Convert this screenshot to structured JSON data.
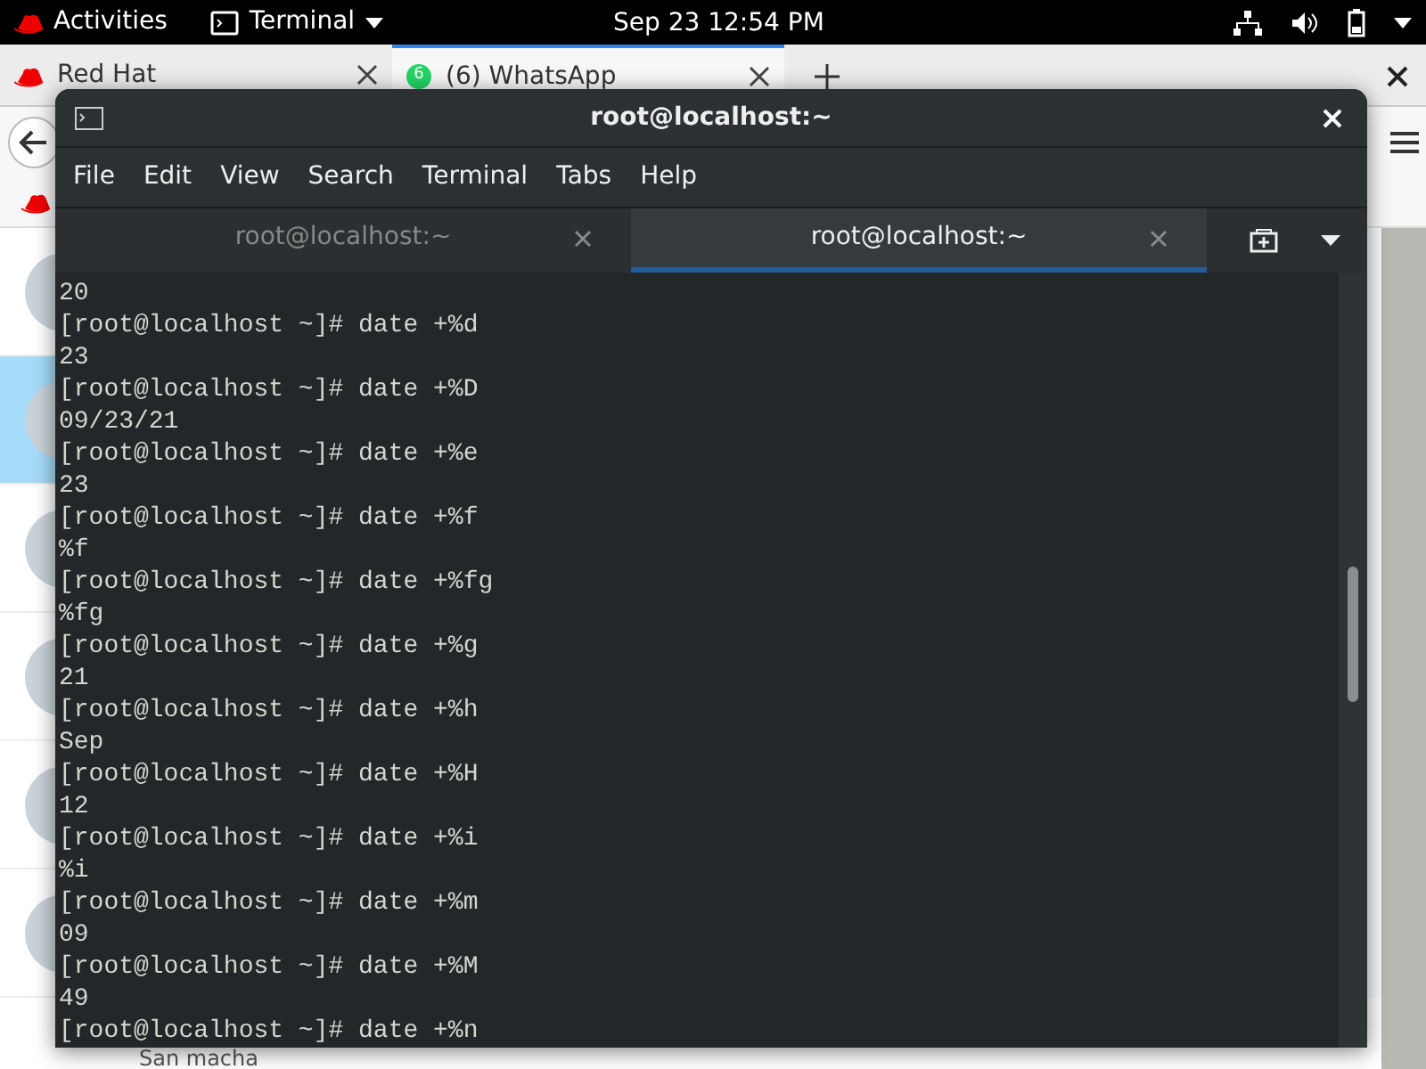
{
  "top_bar": {
    "activities": "Activities",
    "app_menu": "Terminal",
    "clock": "Sep 23  12:54 PM"
  },
  "browser": {
    "tabs": [
      {
        "label": "Red Hat",
        "selected": false
      },
      {
        "label": "(6) WhatsApp",
        "badge": "6",
        "selected": true
      }
    ],
    "chats": [
      {
        "selected": false
      },
      {
        "selected": true
      },
      {
        "selected": false
      },
      {
        "selected": false
      },
      {
        "selected": false
      },
      {
        "selected": false
      }
    ],
    "last_chat_name": "San macha"
  },
  "terminal": {
    "title": "root@localhost:~",
    "menu": [
      "File",
      "Edit",
      "View",
      "Search",
      "Terminal",
      "Tabs",
      "Help"
    ],
    "tabs": [
      {
        "label": "root@localhost:~",
        "selected": false
      },
      {
        "label": "root@localhost:~",
        "selected": true
      }
    ],
    "lines": [
      "20",
      "[root@localhost ~]# date +%d",
      "23",
      "[root@localhost ~]# date +%D",
      "09/23/21",
      "[root@localhost ~]# date +%e",
      "23",
      "[root@localhost ~]# date +%f",
      "%f",
      "[root@localhost ~]# date +%fg",
      "%fg",
      "[root@localhost ~]# date +%g",
      "21",
      "[root@localhost ~]# date +%h",
      "Sep",
      "[root@localhost ~]# date +%H",
      "12",
      "[root@localhost ~]# date +%i",
      "%i",
      "[root@localhost ~]# date +%m",
      "09",
      "[root@localhost ~]# date +%M",
      "49",
      "[root@localhost ~]# date +%n"
    ]
  }
}
